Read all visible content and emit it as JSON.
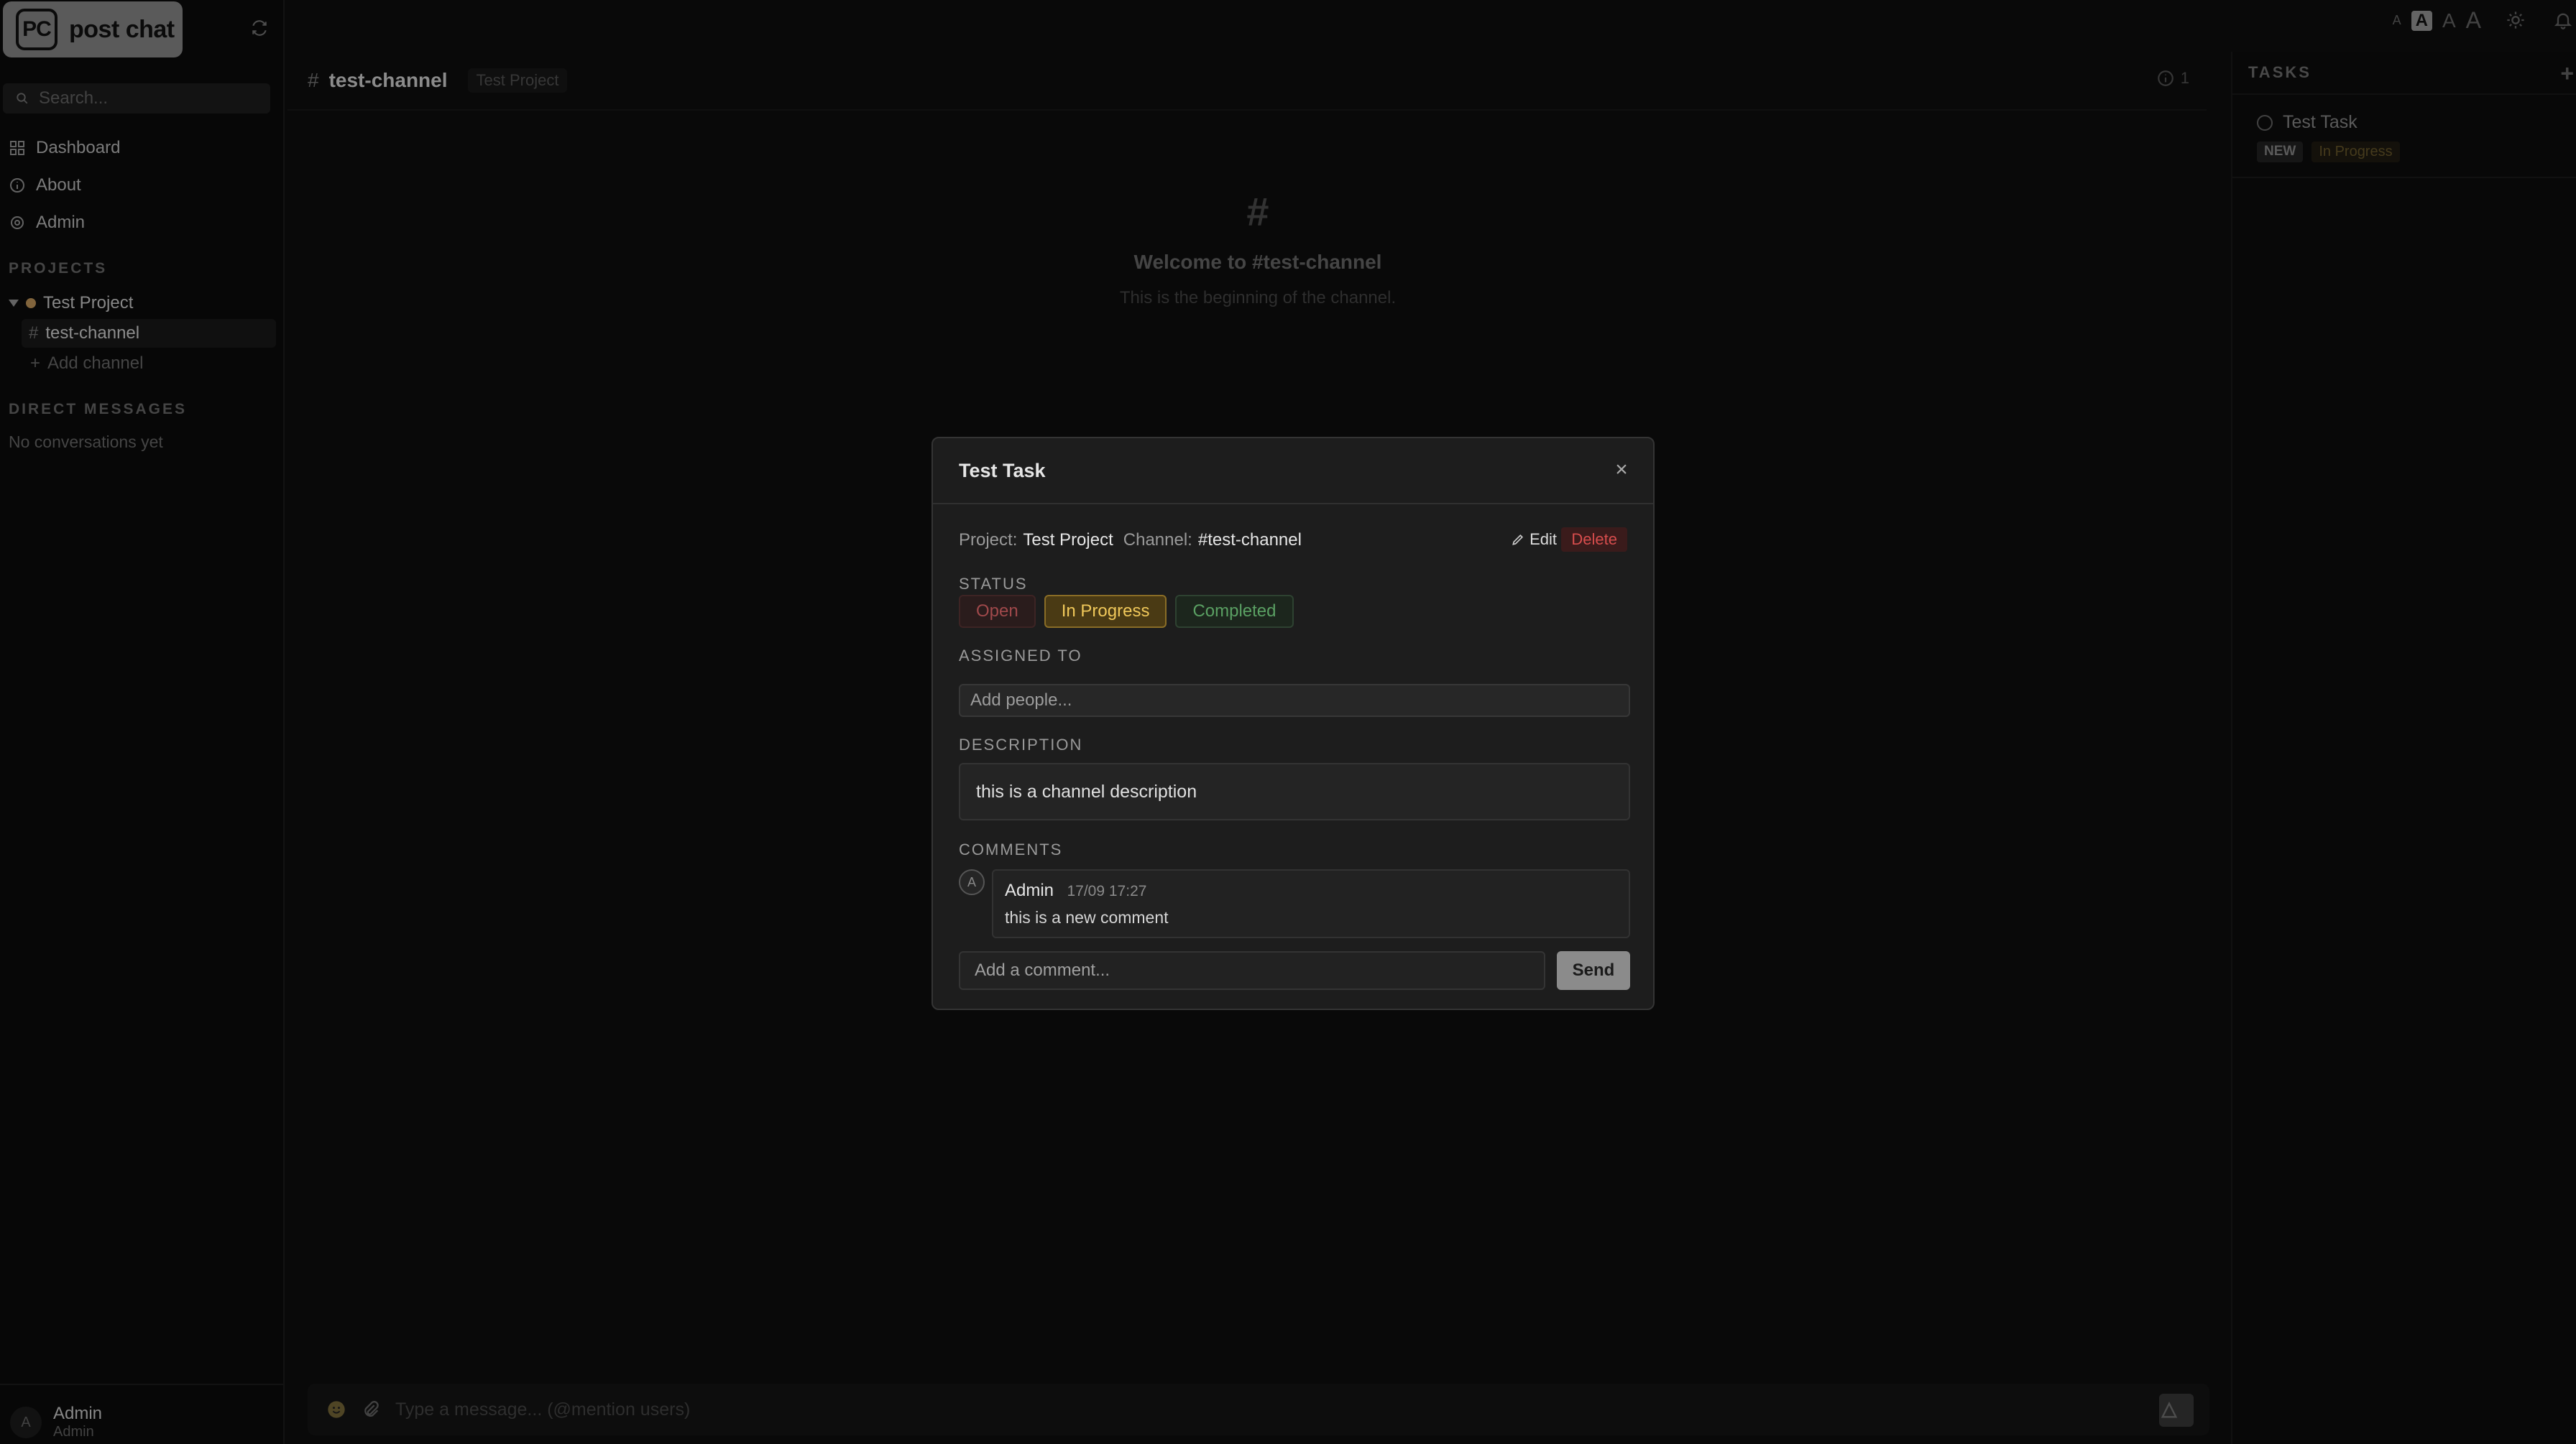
{
  "app": {
    "logo_badge": "PC",
    "logo_text": "post chat"
  },
  "sidebar": {
    "search_placeholder": "Search...",
    "nav": [
      {
        "label": "Dashboard",
        "icon": "grid-icon"
      },
      {
        "label": "About",
        "icon": "info-icon"
      },
      {
        "label": "Admin",
        "icon": "gear-icon"
      }
    ],
    "projects_label": "PROJECTS",
    "project": {
      "name": "Test Project",
      "color": "#c69a5c"
    },
    "channel": {
      "name": "test-channel"
    },
    "add_channel": "Add channel",
    "dm_label": "DIRECT MESSAGES",
    "dm_empty": "No conversations yet",
    "user": {
      "avatar": "A",
      "name": "Admin",
      "role": "Admin"
    }
  },
  "topbar": {
    "font_sizes": [
      "A",
      "A",
      "A",
      "A"
    ],
    "active_font_index": 1
  },
  "channel_header": {
    "hash": "#",
    "name": "test-channel",
    "project": "Test Project",
    "info_count": "1"
  },
  "welcome": {
    "hash": "#",
    "title": "Welcome to #test-channel",
    "subtitle": "This is the beginning of the channel."
  },
  "composer": {
    "placeholder": "Type a message... (@mention users)"
  },
  "tasks": {
    "header": "TASKS",
    "add": "+",
    "items": [
      {
        "title": "Test Task",
        "badge": "NEW",
        "status": "In Progress"
      }
    ]
  },
  "modal": {
    "title": "Test Task",
    "close": "×",
    "project_label": "Project:",
    "project_value": "Test Project",
    "channel_label": "Channel:",
    "channel_value": "#test-channel",
    "edit": "Edit",
    "delete": "Delete",
    "status_label": "STATUS",
    "statuses": [
      "Open",
      "In Progress",
      "Completed"
    ],
    "active_status": "In Progress",
    "assigned_label": "ASSIGNED TO",
    "assigned_placeholder": "Add people...",
    "description_label": "DESCRIPTION",
    "description": "this is a channel description",
    "comments_label": "COMMENTS",
    "comments": [
      {
        "avatar": "A",
        "author": "Admin",
        "time": "17/09 17:27",
        "text": "this is a new comment"
      }
    ],
    "comment_placeholder": "Add a comment...",
    "send": "Send"
  }
}
